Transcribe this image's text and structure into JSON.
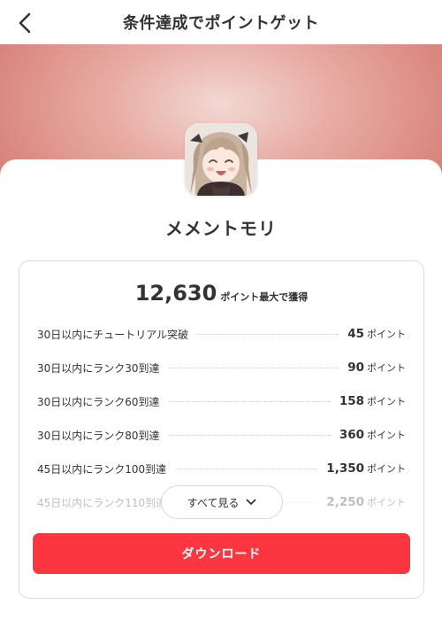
{
  "header": {
    "title": "条件達成でポイントゲット"
  },
  "app": {
    "name": "メメントモリ"
  },
  "summary": {
    "max_points": "12,630",
    "max_suffix": "ポイント最大で獲得"
  },
  "missions": [
    {
      "label": "30日以内にチュートリアル突破",
      "points": "45",
      "unit": "ポイント"
    },
    {
      "label": "30日以内にランク30到達",
      "points": "90",
      "unit": "ポイント"
    },
    {
      "label": "30日以内にランク60到達",
      "points": "158",
      "unit": "ポイント"
    },
    {
      "label": "30日以内にランク80到達",
      "points": "360",
      "unit": "ポイント"
    },
    {
      "label": "45日以内にランク100到達",
      "points": "1,350",
      "unit": "ポイント"
    },
    {
      "label": "45日以内にランク110到達",
      "points": "2,250",
      "unit": "ポイント"
    }
  ],
  "see_all": {
    "label": "すべて見る"
  },
  "download": {
    "label": "ダウンロード"
  },
  "colors": {
    "accent": "#fb3640",
    "hero_center": "#f2d8d3",
    "hero_edge": "#d8837a",
    "text": "#333333"
  },
  "icons": {
    "back": "chevron-left-icon",
    "expand": "chevron-down-icon",
    "app": "app-icon"
  }
}
